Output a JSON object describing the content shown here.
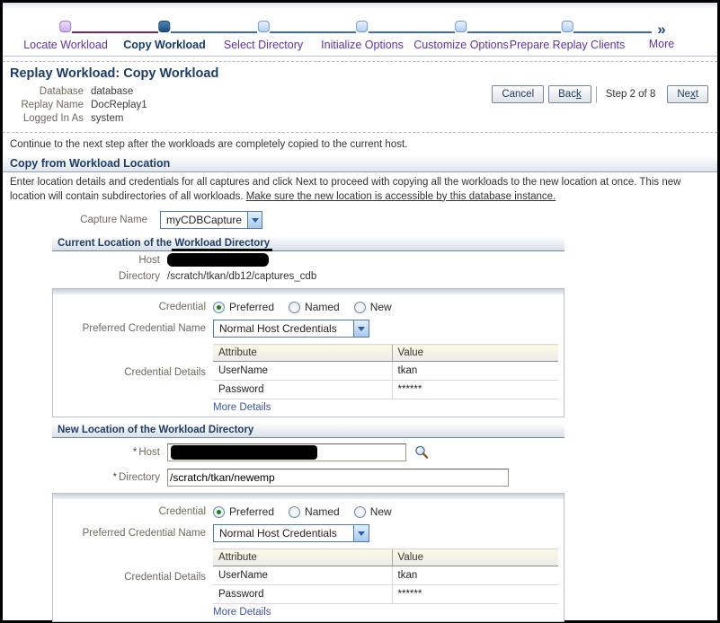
{
  "train": {
    "steps": [
      {
        "label": "Locate Workload",
        "state": "visited"
      },
      {
        "label": "Copy Workload",
        "state": "current"
      },
      {
        "label": "Select Directory",
        "state": "future"
      },
      {
        "label": "Initialize Options",
        "state": "future"
      },
      {
        "label": "Customize Options",
        "state": "future"
      },
      {
        "label": "Prepare Replay Clients",
        "state": "future"
      },
      {
        "label": "More",
        "state": "more"
      }
    ],
    "more_arrow": "»"
  },
  "header": {
    "title": "Replay Workload: Copy Workload",
    "info": [
      {
        "label": "Database",
        "value": "database"
      },
      {
        "label": "Replay Name",
        "value": "DocReplay1"
      },
      {
        "label": "Logged In As",
        "value": "system"
      }
    ],
    "buttons": {
      "cancel": "Cancel",
      "back_pre": "Bac",
      "back_key": "k",
      "step": "Step 2 of 8",
      "next_pre": "Ne",
      "next_key": "x",
      "next_post": "t"
    }
  },
  "instruction": "Continue to the next step after the workloads are completely copied to the current host.",
  "section": {
    "title": "Copy from Workload Location",
    "description": "Enter location details and credentials for all captures and click Next to proceed with copying all the workloads to the new location at once. This new location will contain subdirectories of all workloads. ",
    "description_emphasis": "Make sure the new location is accessible by this database instance.",
    "capture_name_label": "Capture Name",
    "capture_name_value": "myCDBCapture"
  },
  "current_location": {
    "title": "Current Location of the Workload Directory",
    "host_label": "Host",
    "directory_label": "Directory",
    "directory_value": "/scratch/tkan/db12/captures_cdb"
  },
  "new_location": {
    "title": "New Location of the Workload Directory",
    "required_marker": "*",
    "host_label": "Host",
    "directory_label": "Directory",
    "directory_value": "/scratch/tkan/newemp"
  },
  "cred1": {
    "credential_label": "Credential",
    "options": [
      "Preferred",
      "Named",
      "New"
    ],
    "selected_option": "Preferred",
    "preferred_label": "Preferred Credential Name",
    "preferred_value": "Normal Host Credentials",
    "details_label": "Credential Details",
    "table": {
      "headers": [
        "Attribute",
        "Value"
      ],
      "rows": [
        [
          "UserName",
          "tkan"
        ],
        [
          "Password",
          "******"
        ]
      ]
    },
    "more_details": "More Details"
  },
  "cred2": {
    "credential_label": "Credential",
    "options": [
      "Preferred",
      "Named",
      "New"
    ],
    "selected_option": "Preferred",
    "preferred_label": "Preferred Credential Name",
    "preferred_value": "Normal Host Credentials",
    "details_label": "Credential Details",
    "table": {
      "headers": [
        "Attribute",
        "Value"
      ],
      "rows": [
        [
          "UserName",
          "tkan"
        ],
        [
          "Password",
          "******"
        ]
      ]
    },
    "more_details": "More Details"
  }
}
